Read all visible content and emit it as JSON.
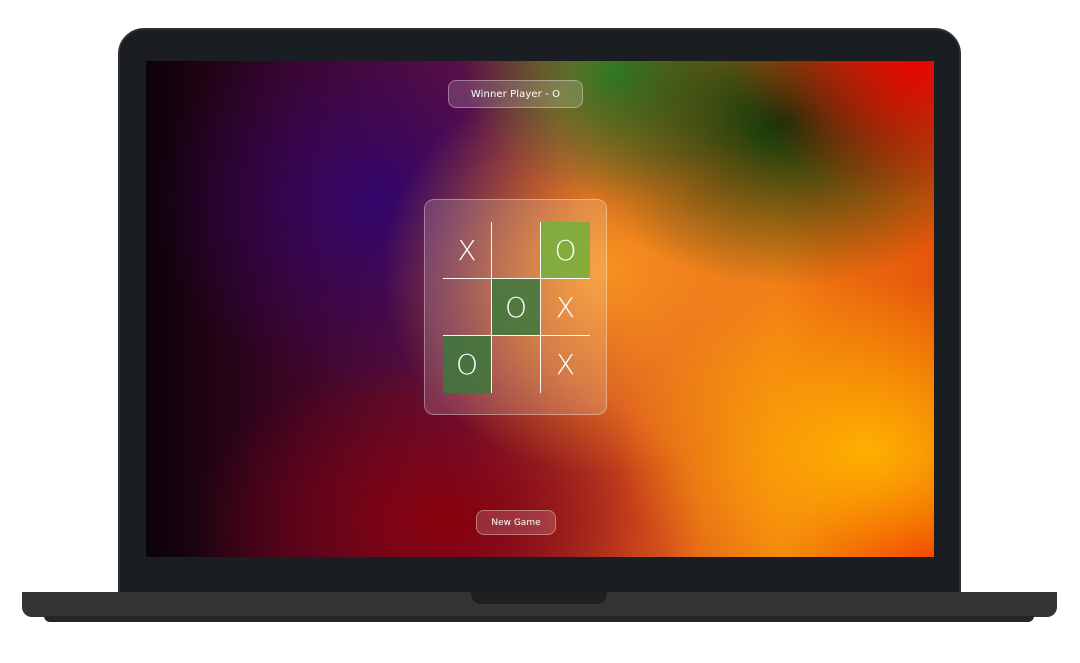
{
  "status": {
    "winner_text": "Winner Player - O"
  },
  "board": {
    "cells": [
      "X",
      "",
      "O",
      "",
      "O",
      "X",
      "O",
      "",
      "X"
    ]
  },
  "controls": {
    "new_game_label": "New Game"
  },
  "colors": {
    "winning_cell": "#3c783c",
    "winning_cell_light": "#78af3c",
    "bezel": "#1a1d21",
    "base": "#343434"
  }
}
